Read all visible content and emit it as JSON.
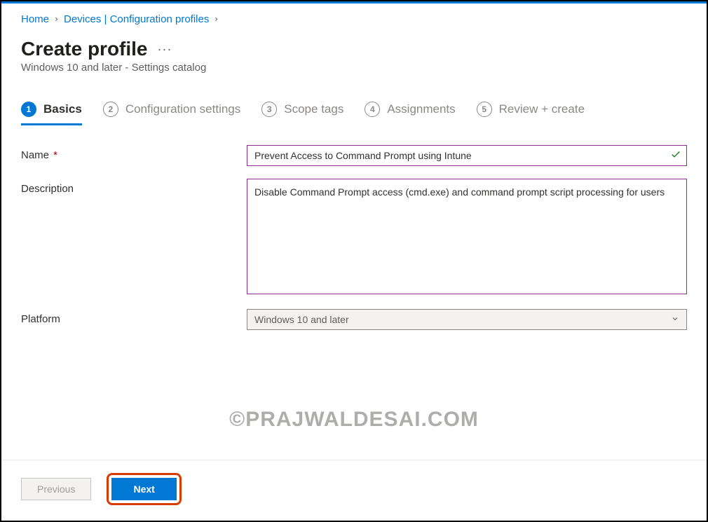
{
  "breadcrumb": {
    "home": "Home",
    "devices": "Devices | Configuration profiles"
  },
  "header": {
    "title": "Create profile",
    "subtitle": "Windows 10 and later - Settings catalog"
  },
  "tabs": [
    {
      "num": "1",
      "label": "Basics"
    },
    {
      "num": "2",
      "label": "Configuration settings"
    },
    {
      "num": "3",
      "label": "Scope tags"
    },
    {
      "num": "4",
      "label": "Assignments"
    },
    {
      "num": "5",
      "label": "Review + create"
    }
  ],
  "form": {
    "name_label": "Name",
    "name_value": "Prevent Access to Command Prompt using Intune",
    "description_label": "Description",
    "description_value": "Disable Command Prompt access (cmd.exe) and command prompt script processing for users",
    "platform_label": "Platform",
    "platform_value": "Windows 10 and later"
  },
  "footer": {
    "previous": "Previous",
    "next": "Next"
  },
  "watermark": "©PRAJWALDESAI.COM"
}
